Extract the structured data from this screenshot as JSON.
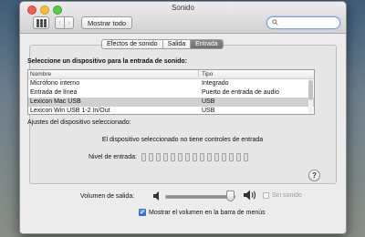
{
  "window": {
    "title": "Sonido",
    "toolbar": {
      "show_all_label": "Mostrar todo",
      "back_glyph": "‹",
      "forward_glyph": "›",
      "search_placeholder": "",
      "search_value": ""
    }
  },
  "tabs": [
    {
      "label": "Efectos de sonido",
      "selected": false
    },
    {
      "label": "Salida",
      "selected": false
    },
    {
      "label": "Entrada",
      "selected": true
    }
  ],
  "input": {
    "heading": "Seleccione un dispositivo para la entrada de sonido:",
    "columns": [
      "Nombre",
      "Tipo"
    ],
    "devices": [
      {
        "name": "Micrófono interno",
        "type": "Integrado",
        "selected": false
      },
      {
        "name": "Entrada de línea",
        "type": "Puerto de entrada de audio",
        "selected": false
      },
      {
        "name": "Lexicon Mac USB",
        "type": "USB",
        "selected": true
      },
      {
        "name": "Lexicon Win USB 1-2 In/Out",
        "type": "USB",
        "selected": false
      }
    ],
    "settings_label": "Ajustes del dispositivo seleccionado:",
    "no_controls_message": "El dispositivo seleccionado no tiene controles de entrada",
    "level_label": "Nivel de entrada:",
    "level_segments": 15,
    "level_value": 0,
    "help_glyph": "?"
  },
  "output_volume": {
    "label": "Volumen de salida:",
    "value_fraction": 0.94,
    "mute_label": "Sin sonido",
    "mute_checked": false,
    "show_in_menubar_label": "Mostrar el volumen en la barra de menús",
    "show_in_menubar_checked": true
  },
  "colors": {
    "selected_tab": "#7c7c7c",
    "selected_row": "#d0d0d0",
    "checkbox_checked": "#3b74d8"
  }
}
